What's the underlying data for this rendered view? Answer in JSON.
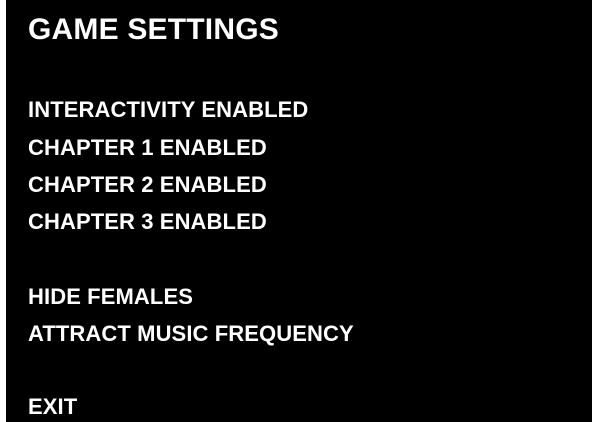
{
  "screen": {
    "title": "GAME SETTINGS",
    "background_color": "#000000",
    "text_color": "#ffffff"
  },
  "menu": {
    "items": [
      {
        "label": "INTERACTIVITY ENABLED"
      },
      {
        "label": "CHAPTER 1 ENABLED"
      },
      {
        "label": "CHAPTER 2 ENABLED"
      },
      {
        "label": "CHAPTER 3 ENABLED"
      },
      {
        "label": "HIDE FEMALES"
      },
      {
        "label": "ATTRACT MUSIC FREQUENCY"
      },
      {
        "label": "EXIT"
      }
    ]
  }
}
